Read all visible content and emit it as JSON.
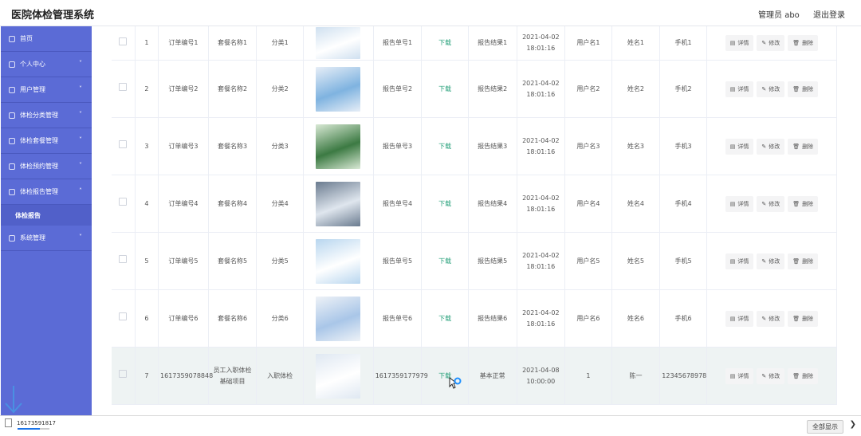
{
  "header": {
    "title": "医院体检管理系统",
    "admin": "管理员 abo",
    "logout": "退出登录"
  },
  "sidebar": {
    "items": [
      {
        "label": "首页",
        "icon": "home-icon",
        "expandable": false
      },
      {
        "label": "个人中心",
        "icon": "user-icon",
        "expandable": true
      },
      {
        "label": "用户管理",
        "icon": "user-manage-icon",
        "expandable": true
      },
      {
        "label": "体检分类管理",
        "icon": "category-icon",
        "expandable": true
      },
      {
        "label": "体检套餐管理",
        "icon": "package-icon",
        "expandable": true
      },
      {
        "label": "体检预约管理",
        "icon": "calendar-icon",
        "expandable": true
      },
      {
        "label": "体检报告管理",
        "icon": "report-icon",
        "expandable": true,
        "expanded": true
      },
      {
        "label": "系统管理",
        "icon": "settings-icon",
        "expandable": true
      }
    ],
    "sub_item": "体检报告"
  },
  "table": {
    "rows": [
      {
        "index": "1",
        "order": "订单编号1",
        "package": "套餐名称1",
        "category": "分类1",
        "report_no": "报告单号1",
        "download": "下载",
        "result": "报告结果1",
        "date": "2021-04-02",
        "time": "18:01:16",
        "username": "用户名1",
        "name": "姓名1",
        "phone": "手机1"
      },
      {
        "index": "2",
        "order": "订单编号2",
        "package": "套餐名称2",
        "category": "分类2",
        "report_no": "报告单号2",
        "download": "下载",
        "result": "报告结果2",
        "date": "2021-04-02",
        "time": "18:01:16",
        "username": "用户名2",
        "name": "姓名2",
        "phone": "手机2"
      },
      {
        "index": "3",
        "order": "订单编号3",
        "package": "套餐名称3",
        "category": "分类3",
        "report_no": "报告单号3",
        "download": "下载",
        "result": "报告结果3",
        "date": "2021-04-02",
        "time": "18:01:16",
        "username": "用户名3",
        "name": "姓名3",
        "phone": "手机3"
      },
      {
        "index": "4",
        "order": "订单编号4",
        "package": "套餐名称4",
        "category": "分类4",
        "report_no": "报告单号4",
        "download": "下载",
        "result": "报告结果4",
        "date": "2021-04-02",
        "time": "18:01:16",
        "username": "用户名4",
        "name": "姓名4",
        "phone": "手机4"
      },
      {
        "index": "5",
        "order": "订单编号5",
        "package": "套餐名称5",
        "category": "分类5",
        "report_no": "报告单号5",
        "download": "下载",
        "result": "报告结果5",
        "date": "2021-04-02",
        "time": "18:01:16",
        "username": "用户名5",
        "name": "姓名5",
        "phone": "手机5"
      },
      {
        "index": "6",
        "order": "订单编号6",
        "package": "套餐名称6",
        "category": "分类6",
        "report_no": "报告单号6",
        "download": "下载",
        "result": "报告结果6",
        "date": "2021-04-02",
        "time": "18:01:16",
        "username": "用户名6",
        "name": "姓名6",
        "phone": "手机6"
      },
      {
        "index": "7",
        "order": "1617359078848",
        "package": "员工入职体检基础项目",
        "category": "入职体检",
        "report_no": "1617359177979",
        "download": "下载",
        "result": "基本正常",
        "date": "2021-04-08",
        "time": "10:00:00",
        "username": "1",
        "name": "陈一",
        "phone": "12345678978"
      }
    ],
    "actions": {
      "detail": "详情",
      "edit": "修改",
      "delete": "删除"
    }
  },
  "bottombar": {
    "download_file": "16173591817",
    "show_all": "全部显示",
    "progress": 0.7
  },
  "colors": {
    "sidebar": "#5b6bd6",
    "download": "#26a07a",
    "highlight_row": "#eef3f3"
  }
}
